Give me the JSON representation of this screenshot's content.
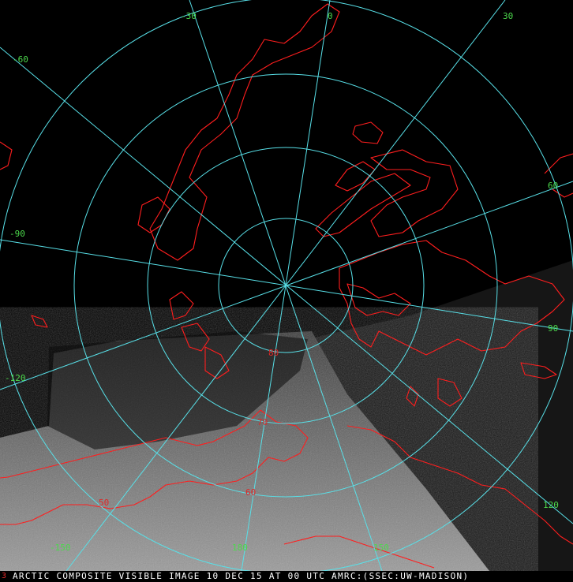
{
  "caption": {
    "index": "3",
    "text": "ARCTIC COMPOSITE VISIBLE IMAGE 10 DEC 15 AT 00 UTC AMRC:(SSEC:UW-MADISON)"
  },
  "latitude_labels": [
    "80",
    "70",
    "60",
    "50"
  ],
  "longitude_labels": [
    "-30",
    "0",
    "30",
    "-60",
    "60",
    "-90",
    "90",
    "-120",
    "120",
    "-150",
    "180",
    "150"
  ],
  "colors": {
    "background": "#000000",
    "graticule": "#58e0e8",
    "coastline": "#ff1e1e",
    "longitude_label": "#4cd94c",
    "latitude_label": "#e02828"
  }
}
